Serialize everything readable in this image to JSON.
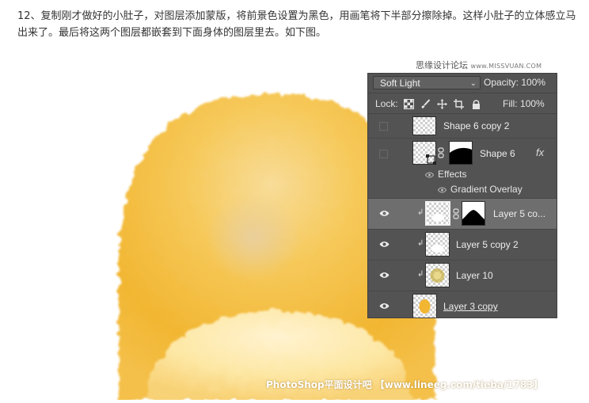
{
  "article": {
    "step_text": "12、复制刚才做好的小肚子，对图层添加蒙版，将前景色设置为黑色，用画笔将下半部分擦除掉。这样小肚子的立体感立马出来了。最后将这两个图层都嵌套到下面身体的图层里去。如下图。"
  },
  "watermarks": {
    "top_cn": "思缘设计论坛",
    "top_site": "www.MISSVUAN.COM",
    "bottom": "PhotoShop平面设计吧 【www.lineeg.com/tieba/1783】"
  },
  "layers_panel": {
    "blend_mode": "Soft Light",
    "opacity_label": "Opacity:",
    "opacity_value": "100%",
    "lock_label": "Lock:",
    "fill_label": "Fill:",
    "fill_value": "100%",
    "layers": [
      {
        "name": "Shape 6 copy 2",
        "visible": false
      },
      {
        "name": "Shape 6",
        "visible": false,
        "fx": "fx"
      },
      {
        "name": "Effects"
      },
      {
        "name": "Gradient Overlay"
      },
      {
        "name": "Layer 5 co...",
        "visible": true,
        "selected": true
      },
      {
        "name": "Layer 5 copy 2",
        "visible": true
      },
      {
        "name": "Layer 10",
        "visible": true
      },
      {
        "name": "Layer 3 copy",
        "visible": true
      }
    ]
  },
  "colors": {
    "panel_bg": "#535353",
    "selected_row": "#6e6e6e",
    "fur_yellow": "#f2b632",
    "fur_light": "#fde7a4"
  }
}
